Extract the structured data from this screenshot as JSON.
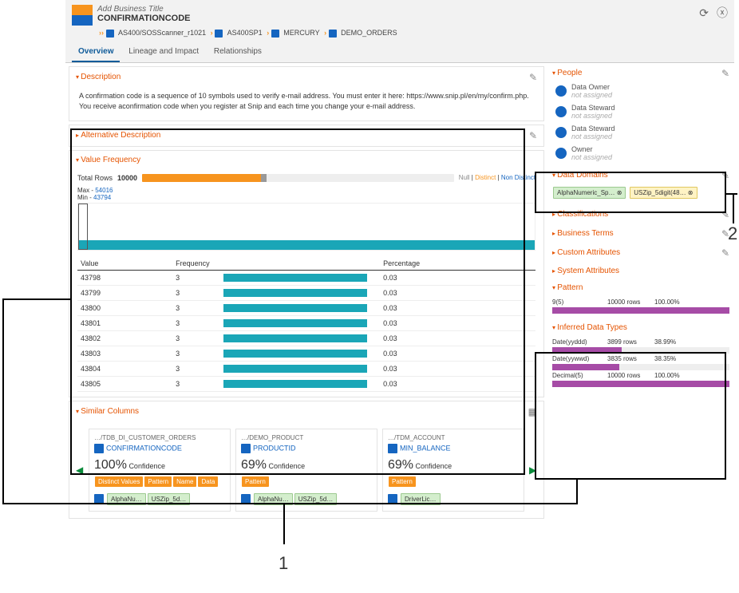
{
  "header": {
    "bizTitle": "Add Business Title",
    "assetName": "CONFIRMATIONCODE"
  },
  "breadcrumb": {
    "c1": "AS400/SOSScanner_r1021",
    "c2": "AS400SP1",
    "c3": "MERCURY",
    "c4": "DEMO_ORDERS"
  },
  "tabs": {
    "overview": "Overview",
    "lineage": "Lineage and Impact",
    "rel": "Relationships"
  },
  "desc": {
    "title": "Description",
    "body": "A confirmation code is a sequence of 10 symbols used to verify e-mail address. You must enter it here: https://www.snip.pl/en/my/confirm.php. You receive aconfirmation code when you register at Snip and each time you change your e-mail address."
  },
  "altDesc": {
    "title": "Alternative Description"
  },
  "vf": {
    "title": "Value Frequency",
    "totalLabel": "Total Rows",
    "total": "10000",
    "null": "Null",
    "dist": "Distinct",
    "nondist": "Non Distinct",
    "maxLabel": "Max - ",
    "max": "54016",
    "minLabel": "Min - ",
    "min": "43794",
    "colValue": "Value",
    "colFreq": "Frequency",
    "colPct": "Percentage",
    "rows": [
      {
        "v": "43798",
        "f": "3",
        "p": "0.03"
      },
      {
        "v": "43799",
        "f": "3",
        "p": "0.03"
      },
      {
        "v": "43800",
        "f": "3",
        "p": "0.03"
      },
      {
        "v": "43801",
        "f": "3",
        "p": "0.03"
      },
      {
        "v": "43802",
        "f": "3",
        "p": "0.03"
      },
      {
        "v": "43803",
        "f": "3",
        "p": "0.03"
      },
      {
        "v": "43804",
        "f": "3",
        "p": "0.03"
      },
      {
        "v": "43805",
        "f": "3",
        "p": "0.03"
      }
    ]
  },
  "similar": {
    "title": "Similar Columns",
    "cards": [
      {
        "path": "…/TDB_DI_CUSTOMER_ORDERS",
        "name": "CONFIRMATIONCODE",
        "conf": "100%",
        "confL": "Confidence",
        "tags": [
          "Distinct Values",
          "Pattern",
          "Name",
          "Data"
        ],
        "domains": [
          "AlphaNu…",
          "USZip_5d…"
        ]
      },
      {
        "path": "…/DEMO_PRODUCT",
        "name": "PRODUCTID",
        "conf": "69%",
        "confL": "Confidence",
        "tags": [
          "Pattern"
        ],
        "domains": [
          "AlphaNu…",
          "USZip_5d…"
        ]
      },
      {
        "path": "…/TDM_ACCOUNT",
        "name": "MIN_BALANCE",
        "conf": "69%",
        "confL": "Confidence",
        "tags": [
          "Pattern"
        ],
        "domains": [
          "DriverLic…"
        ]
      }
    ]
  },
  "right": {
    "people": {
      "title": "People",
      "roles": [
        {
          "r": "Data Owner",
          "na": "not assigned"
        },
        {
          "r": "Data Steward",
          "na": "not assigned"
        },
        {
          "r": "Data Steward",
          "na": "not assigned"
        },
        {
          "r": "Owner",
          "na": "not assigned"
        }
      ]
    },
    "domains": {
      "title": "Data Domains",
      "t1": "AlphaNumeric_Sp…",
      "t2": "USZip_5digit(48…"
    },
    "class": {
      "title": "Classifications"
    },
    "biz": {
      "title": "Business Terms"
    },
    "cust": {
      "title": "Custom Attributes"
    },
    "sys": {
      "title": "System Attributes"
    },
    "pattern": {
      "title": "Pattern",
      "rows": [
        {
          "l": "9(5)",
          "c": "10000 rows",
          "p": "100.00%",
          "w": "100%"
        }
      ]
    },
    "idt": {
      "title": "Inferred Data Types",
      "rows": [
        {
          "l": "Date(yyddd)",
          "c": "3899 rows",
          "p": "38.99%",
          "w": "39%"
        },
        {
          "l": "Date(yywwd)",
          "c": "3835 rows",
          "p": "38.35%",
          "w": "38%"
        },
        {
          "l": "Decimal(5)",
          "c": "10000 rows",
          "p": "100.00%",
          "w": "100%"
        }
      ]
    }
  },
  "annotations": {
    "n1": "1",
    "n2": "2"
  }
}
